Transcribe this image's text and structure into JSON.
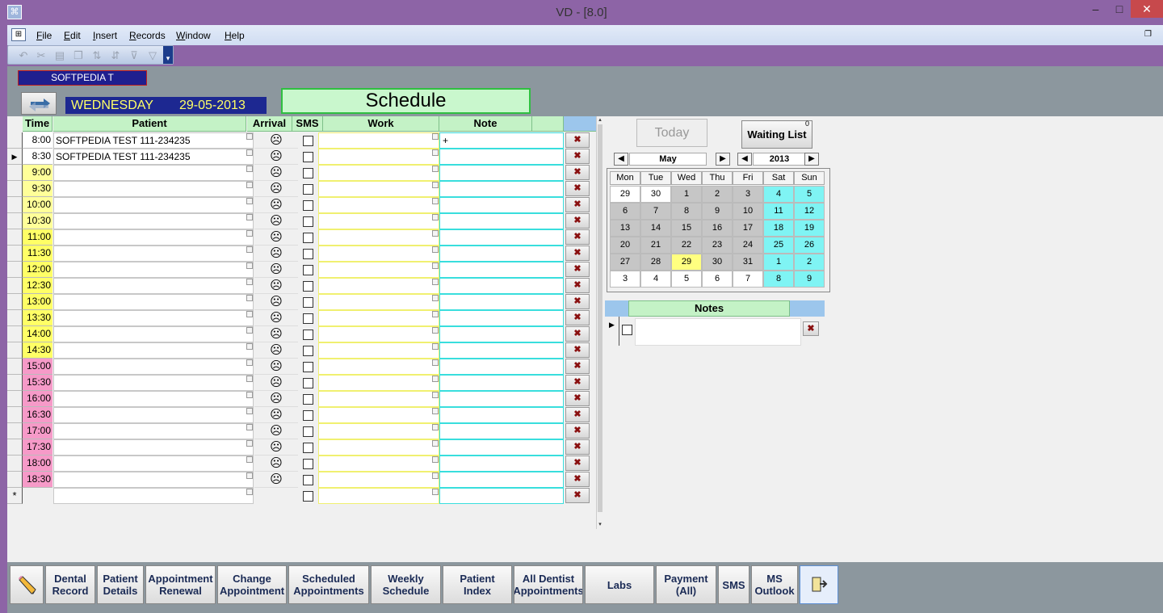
{
  "window": {
    "title": "VD - [8.0]",
    "app_icon": "window-icon",
    "minimize": "–",
    "maximize": "□",
    "close": "✕",
    "accent": "#8d64a6"
  },
  "menu": {
    "items": [
      "File",
      "Edit",
      "Insert",
      "Records",
      "Window",
      "Help"
    ],
    "restore": "❐"
  },
  "toolbar": {
    "icons": [
      "undo-icon",
      "cut-icon",
      "paste-icon",
      "copy-icon",
      "sort-ascending-icon",
      "sort-descending-icon",
      "filter-by-selection-icon",
      "filter-icon"
    ]
  },
  "header": {
    "clinic": "SOFTPEDIA T",
    "day_name": "WEDNESDAY",
    "date": "29-05-2013",
    "title": "Schedule"
  },
  "grid": {
    "columns": {
      "time": "Time",
      "patient": "Patient",
      "arrival": "Arrival",
      "sms": "SMS",
      "work": "Work",
      "note": "Note"
    },
    "rows": [
      {
        "time": "8:00",
        "patient": "SOFTPEDIA TEST 111-234235",
        "note": "+",
        "color": "#ffffff",
        "current": false
      },
      {
        "time": "8:30",
        "patient": "SOFTPEDIA TEST 111-234235",
        "note": "",
        "color": "#ffffff",
        "current": true
      },
      {
        "time": "9:00",
        "patient": "",
        "note": "",
        "color": "#ffff99",
        "current": false
      },
      {
        "time": "9:30",
        "patient": "",
        "note": "",
        "color": "#ffff99",
        "current": false
      },
      {
        "time": "10:00",
        "patient": "",
        "note": "",
        "color": "#ffff99",
        "current": false
      },
      {
        "time": "10:30",
        "patient": "",
        "note": "",
        "color": "#ffff99",
        "current": false
      },
      {
        "time": "11:00",
        "patient": "",
        "note": "",
        "color": "#ffff66",
        "current": false
      },
      {
        "time": "11:30",
        "patient": "",
        "note": "",
        "color": "#ffff66",
        "current": false
      },
      {
        "time": "12:00",
        "patient": "",
        "note": "",
        "color": "#ffff66",
        "current": false
      },
      {
        "time": "12:30",
        "patient": "",
        "note": "",
        "color": "#ffff66",
        "current": false
      },
      {
        "time": "13:00",
        "patient": "",
        "note": "",
        "color": "#ffff66",
        "current": false
      },
      {
        "time": "13:30",
        "patient": "",
        "note": "",
        "color": "#ffff66",
        "current": false
      },
      {
        "time": "14:00",
        "patient": "",
        "note": "",
        "color": "#ffff66",
        "current": false
      },
      {
        "time": "14:30",
        "patient": "",
        "note": "",
        "color": "#ffff66",
        "current": false
      },
      {
        "time": "15:00",
        "patient": "",
        "note": "",
        "color": "#f69ac8",
        "current": false
      },
      {
        "time": "15:30",
        "patient": "",
        "note": "",
        "color": "#f69ac8",
        "current": false
      },
      {
        "time": "16:00",
        "patient": "",
        "note": "",
        "color": "#f69ac8",
        "current": false
      },
      {
        "time": "16:30",
        "patient": "",
        "note": "",
        "color": "#f69ac8",
        "current": false
      },
      {
        "time": "17:00",
        "patient": "",
        "note": "",
        "color": "#f69ac8",
        "current": false
      },
      {
        "time": "17:30",
        "patient": "",
        "note": "",
        "color": "#f69ac8",
        "current": false
      },
      {
        "time": "18:00",
        "patient": "",
        "note": "",
        "color": "#f69ac8",
        "current": false
      },
      {
        "time": "18:30",
        "patient": "",
        "note": "",
        "color": "#f69ac8",
        "current": false
      }
    ],
    "new_row_marker": "*"
  },
  "right": {
    "today": "Today",
    "waiting_list": "Waiting List",
    "waiting_count": "0",
    "month": "May",
    "year": "2013",
    "weekdays": [
      "Mon",
      "Tue",
      "Wed",
      "Thu",
      "Fri",
      "Sat",
      "Sun"
    ],
    "weeks": [
      [
        [
          "29",
          "white"
        ],
        [
          "30",
          "white"
        ],
        [
          "1",
          "gray"
        ],
        [
          "2",
          "gray"
        ],
        [
          "3",
          "gray"
        ],
        [
          "4",
          "cyan"
        ],
        [
          "5",
          "cyan"
        ]
      ],
      [
        [
          "6",
          "gray"
        ],
        [
          "7",
          "gray"
        ],
        [
          "8",
          "gray"
        ],
        [
          "9",
          "gray"
        ],
        [
          "10",
          "gray"
        ],
        [
          "11",
          "cyan"
        ],
        [
          "12",
          "cyan"
        ]
      ],
      [
        [
          "13",
          "gray"
        ],
        [
          "14",
          "gray"
        ],
        [
          "15",
          "gray"
        ],
        [
          "16",
          "gray"
        ],
        [
          "17",
          "gray"
        ],
        [
          "18",
          "cyan"
        ],
        [
          "19",
          "cyan"
        ]
      ],
      [
        [
          "20",
          "gray"
        ],
        [
          "21",
          "gray"
        ],
        [
          "22",
          "gray"
        ],
        [
          "23",
          "gray"
        ],
        [
          "24",
          "gray"
        ],
        [
          "25",
          "cyan"
        ],
        [
          "26",
          "cyan"
        ]
      ],
      [
        [
          "27",
          "gray"
        ],
        [
          "28",
          "gray"
        ],
        [
          "29",
          "yellow"
        ],
        [
          "30",
          "gray"
        ],
        [
          "31",
          "gray"
        ],
        [
          "1",
          "cyan"
        ],
        [
          "2",
          "cyan"
        ]
      ],
      [
        [
          "3",
          "white"
        ],
        [
          "4",
          "white"
        ],
        [
          "5",
          "white"
        ],
        [
          "6",
          "white"
        ],
        [
          "7",
          "white"
        ],
        [
          "8",
          "cyan"
        ],
        [
          "9",
          "cyan"
        ]
      ]
    ],
    "notes_title": "Notes"
  },
  "bottom": {
    "buttons": [
      {
        "label": "",
        "name": "edit-pencil-button",
        "width": 42
      },
      {
        "label": "Dental Record",
        "name": "dental-record-button",
        "width": 62
      },
      {
        "label": "Patient Details",
        "name": "patient-details-button",
        "width": 58
      },
      {
        "label": "Appointment Renewal",
        "name": "appointment-renewal-button",
        "width": 87
      },
      {
        "label": "Change Appointment",
        "name": "change-appointment-button",
        "width": 86
      },
      {
        "label": "Scheduled Appointments",
        "name": "scheduled-appointments-button",
        "width": 100
      },
      {
        "label": "Weekly Schedule",
        "name": "weekly-schedule-button",
        "width": 87
      },
      {
        "label": "Patient Index",
        "name": "patient-index-button",
        "width": 86
      },
      {
        "label": "All Dentist Appointments",
        "name": "all-dentist-appointments-button",
        "width": 86
      },
      {
        "label": "Labs",
        "name": "labs-button",
        "width": 86
      },
      {
        "label": "Payment (All)",
        "name": "payment-all-button",
        "width": 75
      },
      {
        "label": "SMS",
        "name": "sms-button",
        "width": 39
      },
      {
        "label": "MS Outlook",
        "name": "ms-outlook-button",
        "width": 58
      },
      {
        "label": "",
        "name": "exit-button",
        "width": 48
      }
    ]
  }
}
